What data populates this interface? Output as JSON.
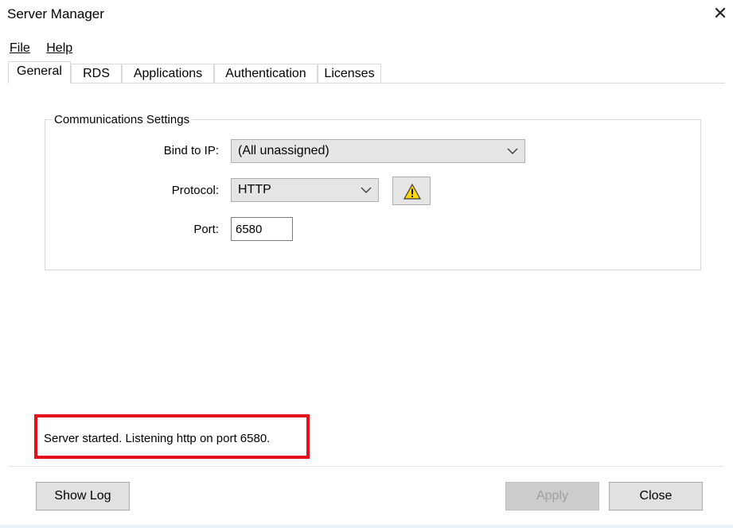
{
  "window": {
    "title": "Server Manager",
    "close_glyph": "✕"
  },
  "menu": {
    "file": "File",
    "help": "Help"
  },
  "tabs": [
    {
      "label": "General",
      "active": true
    },
    {
      "label": "RDS",
      "active": false
    },
    {
      "label": "Applications",
      "active": false
    },
    {
      "label": "Authentication",
      "active": false
    },
    {
      "label": "Licenses",
      "active": false
    }
  ],
  "comm": {
    "group_title": "Communications Settings",
    "bind_label": "Bind to IP:",
    "bind_value": "(All unassigned)",
    "protocol_label": "Protocol:",
    "protocol_value": "HTTP",
    "port_label": "Port:",
    "port_value": "6580",
    "warning_icon": "warning-icon"
  },
  "status": {
    "text": "Server started. Listening http on port 6580."
  },
  "buttons": {
    "show_log": "Show Log",
    "apply": "Apply",
    "close": "Close"
  },
  "colors": {
    "highlight_border": "#e3101c",
    "warning_fill": "#ffd800"
  }
}
